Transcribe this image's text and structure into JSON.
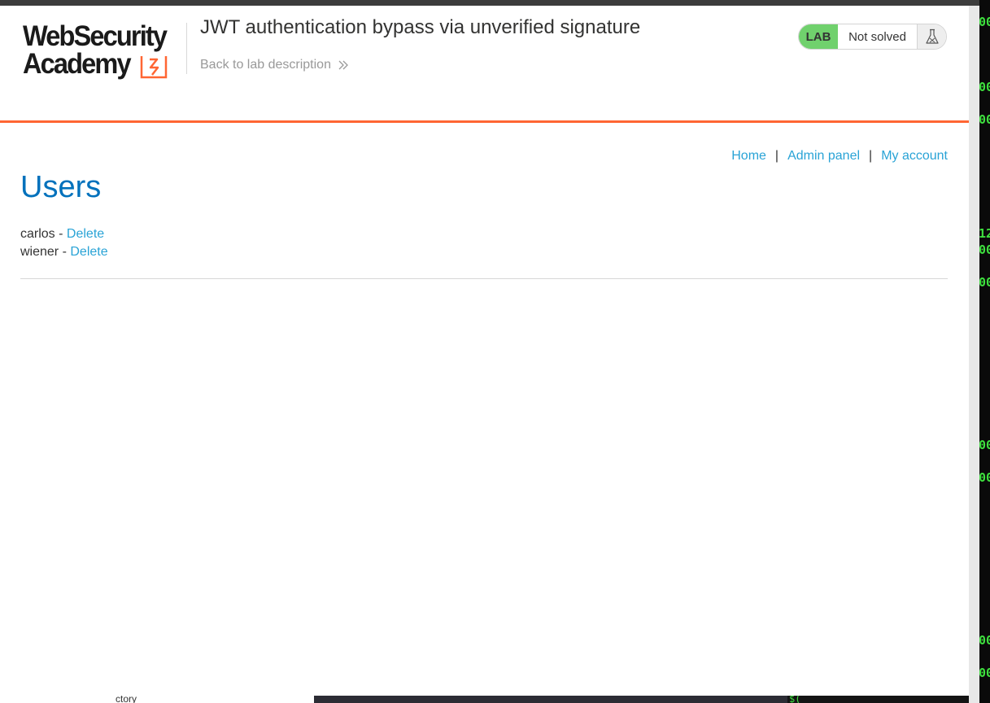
{
  "header": {
    "logo": {
      "line1": "WebSecurity",
      "line2": "Academy"
    },
    "lab_title": "JWT authentication bypass via unverified signature",
    "back_link": "Back to lab description",
    "status": {
      "badge": "LAB",
      "state": "Not solved",
      "icon": "flask-icon"
    }
  },
  "nav": {
    "items": [
      {
        "label": "Home"
      },
      {
        "label": "Admin panel"
      },
      {
        "label": "My account"
      }
    ],
    "separator": "|"
  },
  "main": {
    "title": "Users",
    "users": [
      {
        "name": "carlos",
        "dash": "-",
        "action": "Delete"
      },
      {
        "name": "wiener",
        "dash": "-",
        "action": "Delete"
      }
    ]
  },
  "background_terminal": {
    "lines": [
      "00",
      "00",
      "00",
      "12",
      "00",
      "00",
      "00",
      "00",
      "00",
      "00"
    ]
  },
  "bottom_window": {
    "left_fragment": "ctory",
    "right_fragment": "$("
  },
  "colors": {
    "accent_orange": "#ff6633",
    "link_blue": "#29a3d6",
    "title_blue": "#0071bc",
    "lab_green": "#70d16d",
    "terminal_green": "#3fe03f"
  }
}
